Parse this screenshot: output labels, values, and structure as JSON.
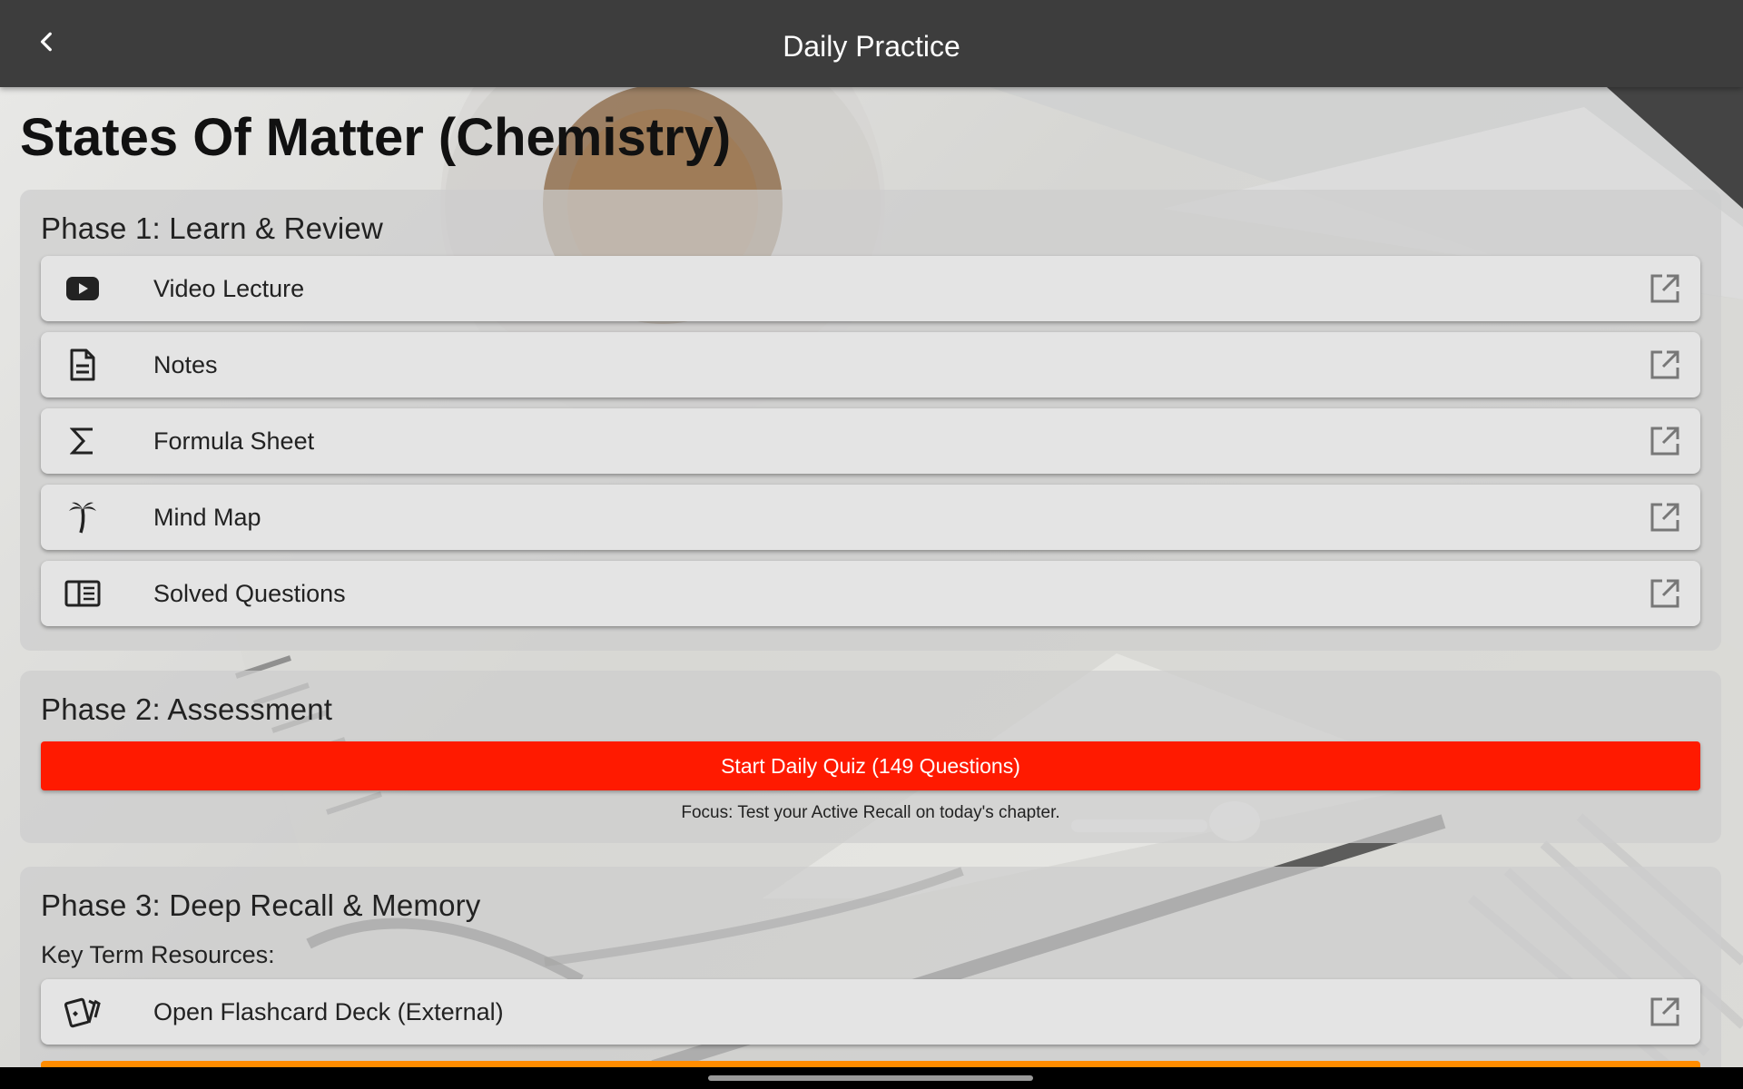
{
  "appbar": {
    "title": "Daily Practice",
    "back_icon": "chevron-left-icon"
  },
  "page": {
    "title": "States Of Matter (Chemistry)"
  },
  "phase1": {
    "heading": "Phase 1: Learn & Review",
    "items": [
      {
        "label": "Video Lecture",
        "icon": "video-play-icon"
      },
      {
        "label": "Notes",
        "icon": "document-icon"
      },
      {
        "label": "Formula Sheet",
        "icon": "sigma-icon"
      },
      {
        "label": "Mind Map",
        "icon": "palm-tree-icon"
      },
      {
        "label": "Solved Questions",
        "icon": "book-open-icon"
      }
    ]
  },
  "phase2": {
    "heading": "Phase 2: Assessment",
    "quiz_button": "Start Daily Quiz (149 Questions)",
    "focus_text": "Focus: Test your Active Recall on today's chapter."
  },
  "phase3": {
    "heading": "Phase 3: Deep Recall & Memory",
    "subheading": "Key Term Resources:",
    "items": [
      {
        "label": "Open Flashcard Deck (External)",
        "icon": "cards-icon"
      }
    ]
  },
  "colors": {
    "appbar": "#3d3d3d",
    "quiz_button": "#ff1a00",
    "orange_button": "#ff8c00"
  }
}
